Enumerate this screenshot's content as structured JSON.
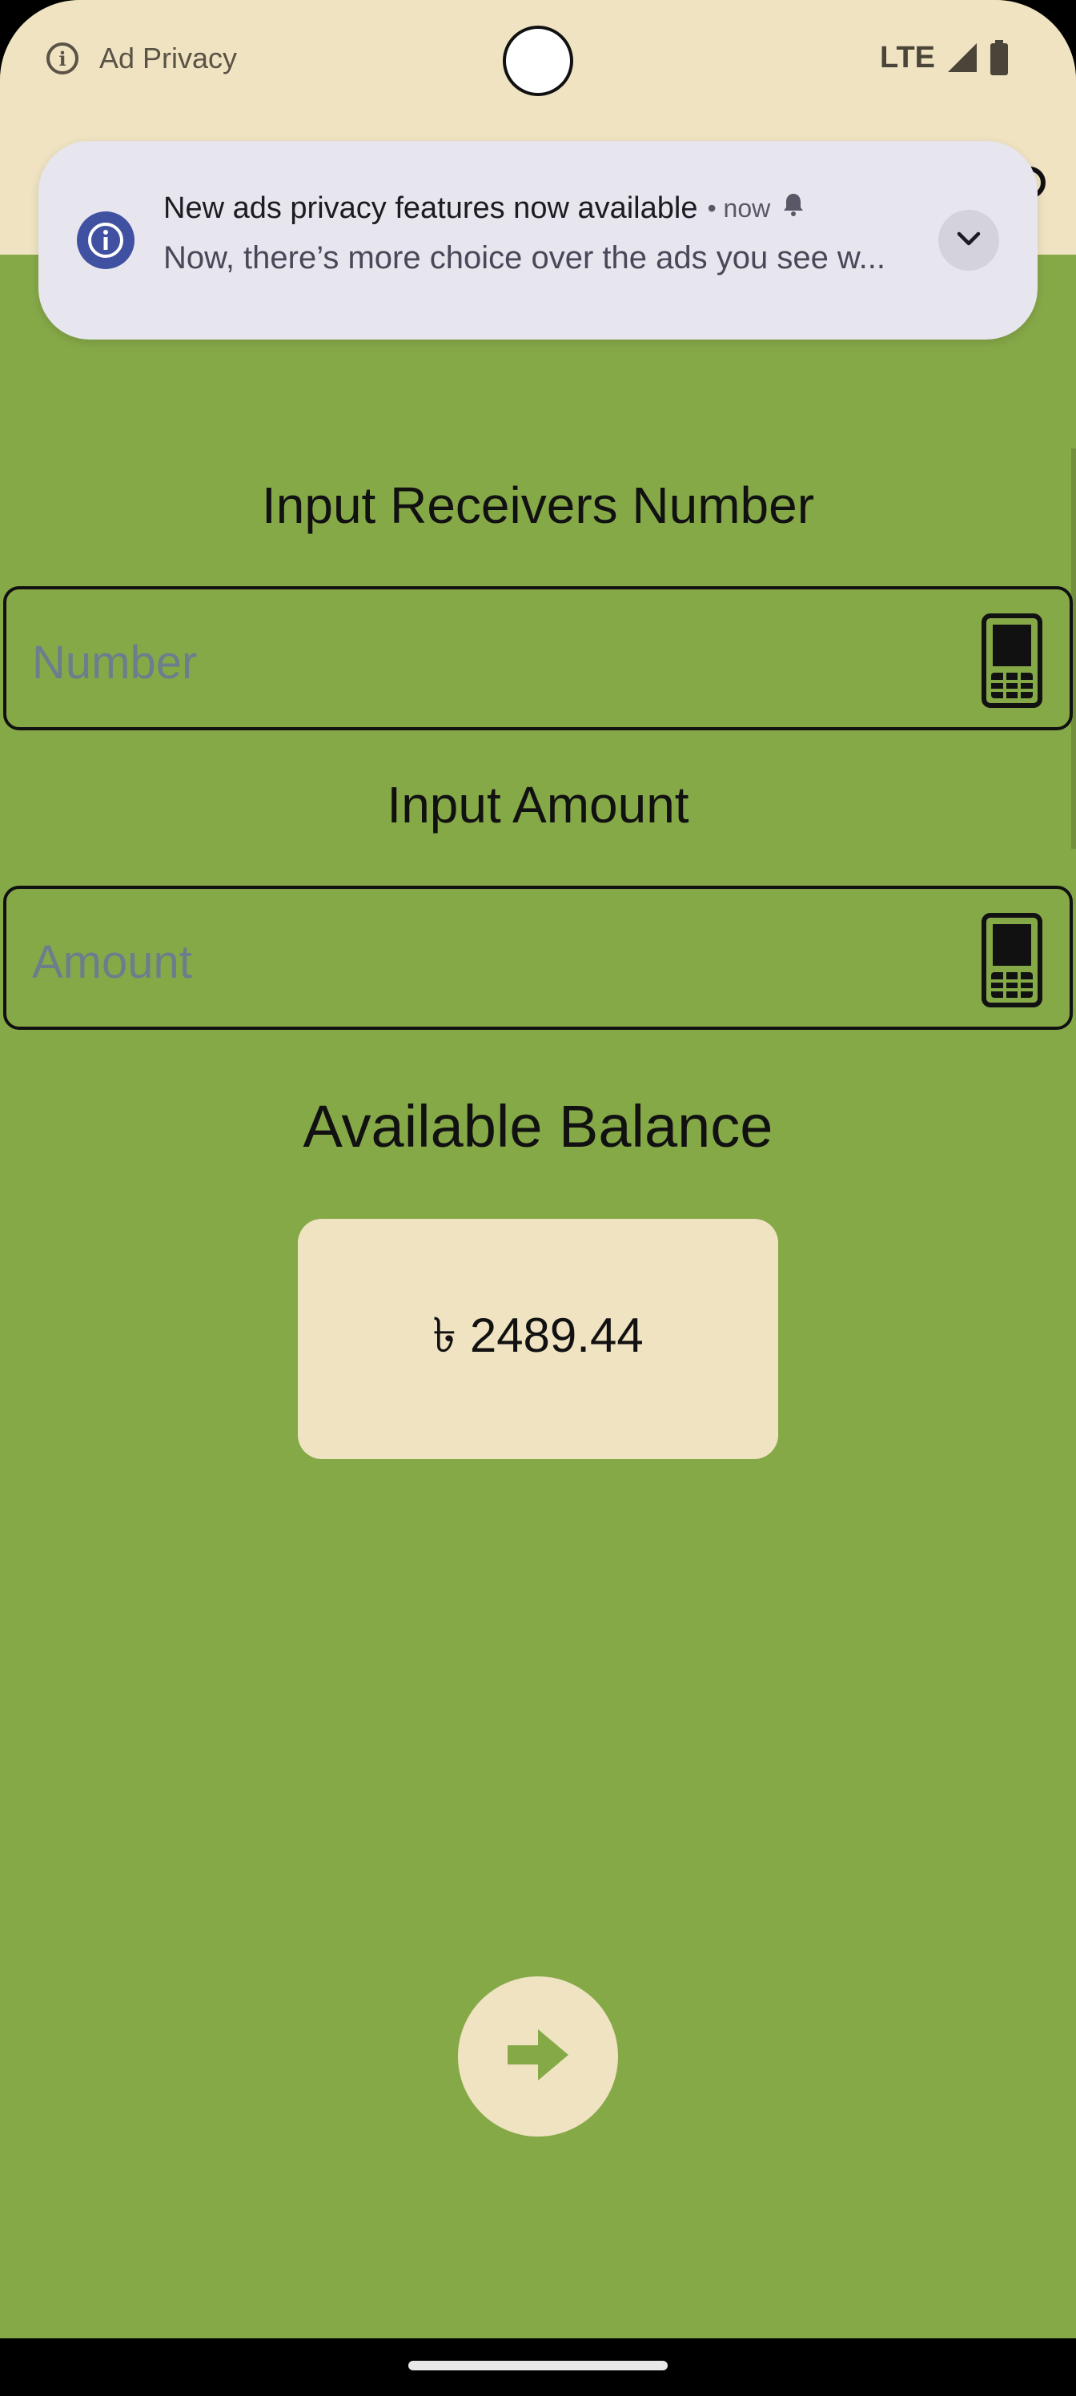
{
  "status_bar": {
    "app_label": "Ad Privacy",
    "network": "LTE"
  },
  "notification": {
    "title": "New ads privacy features now available",
    "time": "• now",
    "body": "Now, there’s more choice over the ads you see w..."
  },
  "form": {
    "receiver_label": "Input Receivers Number",
    "number_placeholder": "Number",
    "amount_label": "Input Amount",
    "amount_placeholder": "Amount"
  },
  "balance": {
    "label": "Available Balance",
    "value": "৳ 2489.44"
  },
  "icons": {
    "status": "info-outline-icon",
    "signal": "signal-icon",
    "battery": "battery-icon",
    "notification": "info-icon",
    "alert": "bell-icon",
    "expand": "chevron-down-icon",
    "field": "phone-icon",
    "next": "arrow-right-icon"
  },
  "colors": {
    "background": "#86a948",
    "top_bar": "#efe3c2",
    "card": "#efe3c2",
    "notification": "#e7e5ee",
    "accent": "#3f51a0"
  }
}
